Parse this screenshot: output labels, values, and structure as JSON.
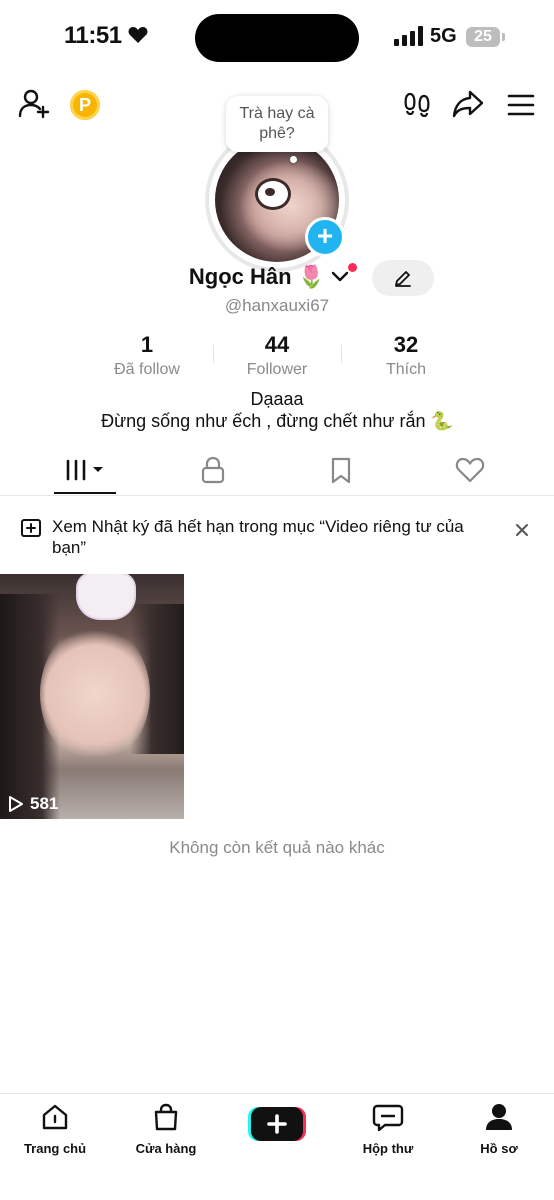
{
  "status_bar": {
    "time": "11:51",
    "network": "5G",
    "battery": "25"
  },
  "header": {
    "coin_label": "P"
  },
  "profile": {
    "bubble_text": "Trà hay cà phê?",
    "display_name": "Ngọc Hân 🌷",
    "username": "@hanxauxi67",
    "stats": [
      {
        "value": "1",
        "label": "Đã follow"
      },
      {
        "value": "44",
        "label": "Follower"
      },
      {
        "value": "32",
        "label": "Thích"
      }
    ],
    "bio_line1": "Dạaaa",
    "bio_line2": "Đừng sống như ếch , đừng chết như rắn 🐍"
  },
  "notice": {
    "text": "Xem Nhật ký đã hết hạn trong mục “Video riêng tư của bạn”"
  },
  "videos": [
    {
      "views": "581"
    }
  ],
  "empty_text": "Không còn kết quả nào khác",
  "bottom_nav": [
    {
      "label": "Trang chủ"
    },
    {
      "label": "Cửa hàng"
    },
    {
      "label": "Hộp thư"
    },
    {
      "label": "Hồ sơ"
    }
  ],
  "colors": {
    "accent_blue": "#20b5f0",
    "coin": "#f7b500",
    "tiktok_red": "#fe2c55",
    "tiktok_cyan": "#25f4ee"
  }
}
